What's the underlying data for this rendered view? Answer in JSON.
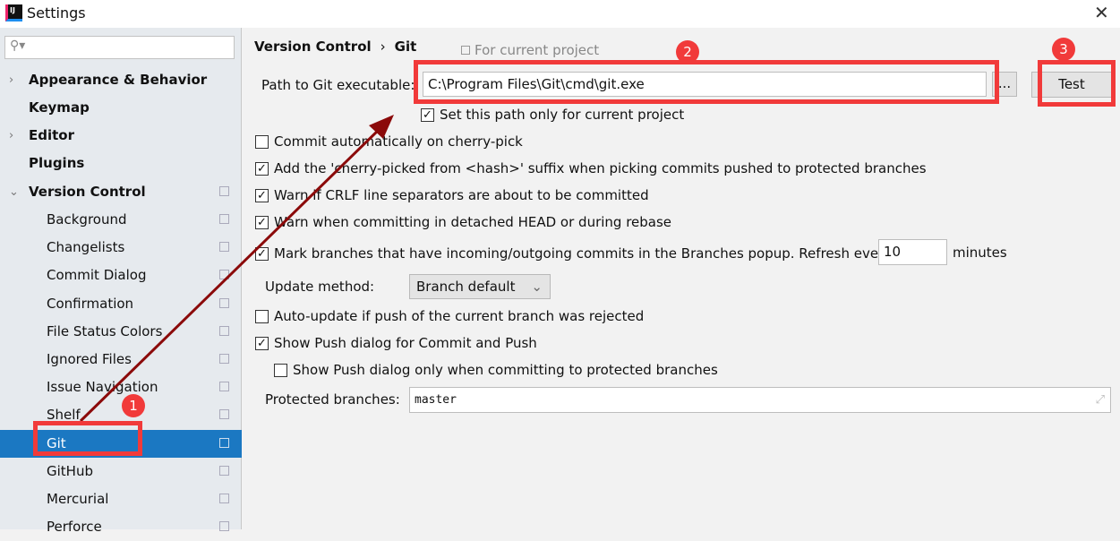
{
  "window": {
    "title": "Settings",
    "close": "✕"
  },
  "search": {
    "placeholder": "",
    "icon": "search-icon"
  },
  "sidebar": {
    "items": [
      {
        "label": "Appearance & Behavior",
        "expand": "›"
      },
      {
        "label": "Keymap"
      },
      {
        "label": "Editor",
        "expand": "›"
      },
      {
        "label": "Plugins"
      },
      {
        "label": "Version Control",
        "expand": "⌄"
      },
      {
        "label": "Background"
      },
      {
        "label": "Changelists"
      },
      {
        "label": "Commit Dialog"
      },
      {
        "label": "Confirmation"
      },
      {
        "label": "File Status Colors"
      },
      {
        "label": "Ignored Files"
      },
      {
        "label": "Issue Navigation"
      },
      {
        "label": "Shelf"
      },
      {
        "label": "Git",
        "selected": true
      },
      {
        "label": "GitHub"
      },
      {
        "label": "Mercurial"
      },
      {
        "label": "Perforce"
      }
    ]
  },
  "breadcrumb": {
    "parent": "Version Control",
    "sep": "›",
    "current": "Git",
    "scope": "For current project"
  },
  "git": {
    "path_label": "Path to Git executable:",
    "path_value": "C:\\Program Files\\Git\\cmd\\git.exe",
    "browse": "...",
    "test": "Test",
    "set_path_only": {
      "label": "Set this path only for current project",
      "checked": true
    },
    "options": [
      {
        "label": "Commit automatically on cherry-pick",
        "checked": false
      },
      {
        "label": "Add the 'cherry-picked from <hash>' suffix when picking commits pushed to protected branches",
        "checked": true
      },
      {
        "label": "Warn if CRLF line separators are about to be committed",
        "checked": true
      },
      {
        "label": "Warn when committing in detached HEAD or during rebase",
        "checked": true
      },
      {
        "label": "Mark branches that have incoming/outgoing commits in the Branches popup.  Refresh every",
        "checked": true
      },
      {
        "label": "Auto-update if push of the current branch was rejected",
        "checked": false
      },
      {
        "label": "Show Push dialog for Commit and Push",
        "checked": true
      },
      {
        "label": "Show Push dialog only when committing to protected branches",
        "checked": false
      }
    ],
    "refresh_value": "10",
    "refresh_unit": "minutes",
    "update_label": "Update method:",
    "update_value": "Branch default",
    "protected_label": "Protected branches:",
    "protected_value": "master"
  },
  "annotations": [
    "1",
    "2",
    "3"
  ],
  "colors": {
    "annotation": "#f13a3a",
    "arrow": "#8b0a0a",
    "selection": "#1b78c2"
  }
}
